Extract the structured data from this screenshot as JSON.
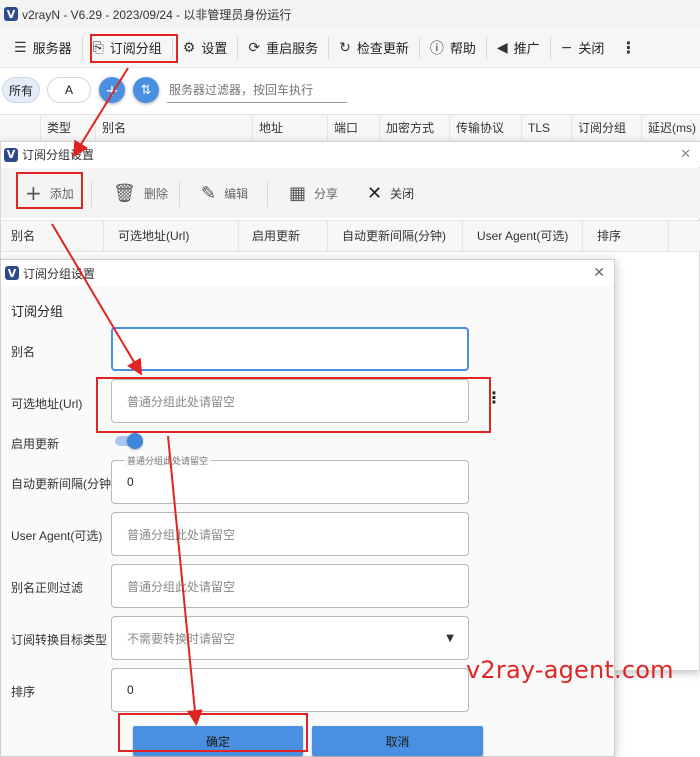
{
  "main_window": {
    "title": "v2rayN - V6.29 - 2023/09/24 - 以非管理员身份运行",
    "toolbar": [
      {
        "label": "服务器",
        "icon": "menu-icon"
      },
      {
        "label": "订阅分组",
        "icon": "subscription-icon"
      },
      {
        "label": "设置",
        "icon": "gear-icon"
      },
      {
        "label": "重启服务",
        "icon": "refresh-icon"
      },
      {
        "label": "检查更新",
        "icon": "update-icon"
      },
      {
        "label": "帮助",
        "icon": "help-icon"
      },
      {
        "label": "推广",
        "icon": "speaker-icon"
      },
      {
        "label": "关闭",
        "icon": "minus-icon"
      }
    ],
    "filter": {
      "tab_all": "所有",
      "tab_a": "A",
      "add_symbol": "+",
      "placeholder": "服务器过滤器，按回车执行"
    },
    "columns": [
      "类型",
      "别名",
      "地址",
      "端口",
      "加密方式",
      "传输协议",
      "TLS",
      "订阅分组",
      "延迟(ms)"
    ]
  },
  "subscription_dialog": {
    "title": "订阅分组设置",
    "toolbar": {
      "add": "添加",
      "delete": "删除",
      "edit": "编辑",
      "share": "分享",
      "close": "关闭"
    },
    "columns": [
      "别名",
      "可选地址(Url)",
      "启用更新",
      "自动更新间隔(分钟)",
      "User Agent(可选)",
      "排序"
    ]
  },
  "edit_dialog": {
    "title": "订阅分组设置",
    "section": "订阅分组",
    "fields": {
      "alias_label": "别名",
      "alias_value": "",
      "url_label": "可选地址(Url)",
      "url_placeholder": "普通分组此处请留空",
      "enable_update_label": "启用更新",
      "enable_update": true,
      "interval_label": "自动更新间隔(分钟)",
      "interval_float_label": "普通分组此处请留空",
      "interval_value": "0",
      "user_agent_label": "User Agent(可选)",
      "user_agent_placeholder": "普通分组此处请留空",
      "alias_filter_label": "别名正则过滤",
      "alias_filter_placeholder": "普通分组此处请留空",
      "convert_target_label": "订阅转换目标类型",
      "convert_target_placeholder": "不需要转换时请留空",
      "sort_label": "排序",
      "sort_value": "0"
    },
    "confirm": "确定",
    "cancel": "取消"
  },
  "watermark": "v2ray-agent.com",
  "colors": {
    "accent": "#4a90e2",
    "highlight_red": "#e02424"
  }
}
